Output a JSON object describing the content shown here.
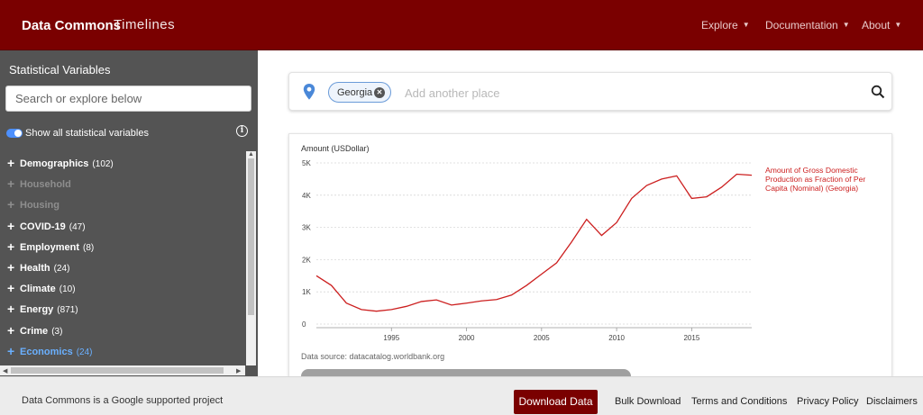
{
  "header": {
    "brand": "Data Commons",
    "subtitle": "Timelines",
    "nav": [
      "Explore",
      "Documentation",
      "About"
    ]
  },
  "sidebar": {
    "title": "Statistical Variables",
    "search_placeholder": "Search or explore below",
    "toggle_label": "Show all statistical variables",
    "items": [
      {
        "label": "Demographics",
        "count": "(102)",
        "state": "normal"
      },
      {
        "label": "Household",
        "count": "",
        "state": "disabled"
      },
      {
        "label": "Housing",
        "count": "",
        "state": "disabled"
      },
      {
        "label": "COVID-19",
        "count": "(47)",
        "state": "normal"
      },
      {
        "label": "Employment",
        "count": "(8)",
        "state": "normal"
      },
      {
        "label": "Health",
        "count": "(24)",
        "state": "normal"
      },
      {
        "label": "Climate",
        "count": "(10)",
        "state": "normal"
      },
      {
        "label": "Energy",
        "count": "(871)",
        "state": "normal"
      },
      {
        "label": "Crime",
        "count": "(3)",
        "state": "normal"
      },
      {
        "label": "Economics",
        "count": "(24)",
        "state": "active"
      }
    ]
  },
  "place_search": {
    "chip_label": "Georgia",
    "placeholder": "Add another place"
  },
  "chart_data": {
    "type": "line",
    "ylabel": "Amount (USDollar)",
    "xlabel": "",
    "title": "",
    "ylim": [
      0,
      5000
    ],
    "xlim": [
      1990,
      2019
    ],
    "y_ticks": [
      0,
      1000,
      2000,
      3000,
      4000,
      5000
    ],
    "y_tick_labels": [
      "0",
      "1K",
      "2K",
      "3K",
      "4K",
      "5K"
    ],
    "x_ticks": [
      1995,
      2000,
      2005,
      2010,
      2015
    ],
    "x_tick_labels": [
      "1995",
      "2000",
      "2005",
      "2010",
      "2015"
    ],
    "series": [
      {
        "name": "Amount of Gross Domestic Production as Fraction of Per Capita (Nominal) (Georgia)",
        "color": "#cc1f1f",
        "x": [
          1990,
          1991,
          1992,
          1993,
          1994,
          1995,
          1996,
          1997,
          1998,
          1999,
          2000,
          2001,
          2002,
          2003,
          2004,
          2005,
          2006,
          2007,
          2008,
          2009,
          2010,
          2011,
          2012,
          2013,
          2014,
          2015,
          2016,
          2017,
          2018,
          2019
        ],
        "values": [
          1500,
          1200,
          650,
          450,
          400,
          450,
          550,
          700,
          750,
          590,
          650,
          720,
          760,
          900,
          1200,
          1550,
          1900,
          2550,
          3250,
          2750,
          3150,
          3900,
          4300,
          4500,
          4600,
          3900,
          3950,
          4250,
          4650,
          4620
        ]
      }
    ],
    "legend": "right",
    "grid": "horizontal-dotted"
  },
  "chart_footer": {
    "data_source": "Data source: datacatalog.worldbank.org"
  },
  "footer": {
    "text": "Data Commons is a Google supported project",
    "download": "Download Data",
    "links": [
      "Bulk Download",
      "Terms and Conditions",
      "Privacy Policy",
      "Disclaimers"
    ]
  },
  "colors": {
    "brand": "#7a0000",
    "sidebar": "#545454",
    "series": "#cc1f1f",
    "active": "#6ab0ff"
  }
}
